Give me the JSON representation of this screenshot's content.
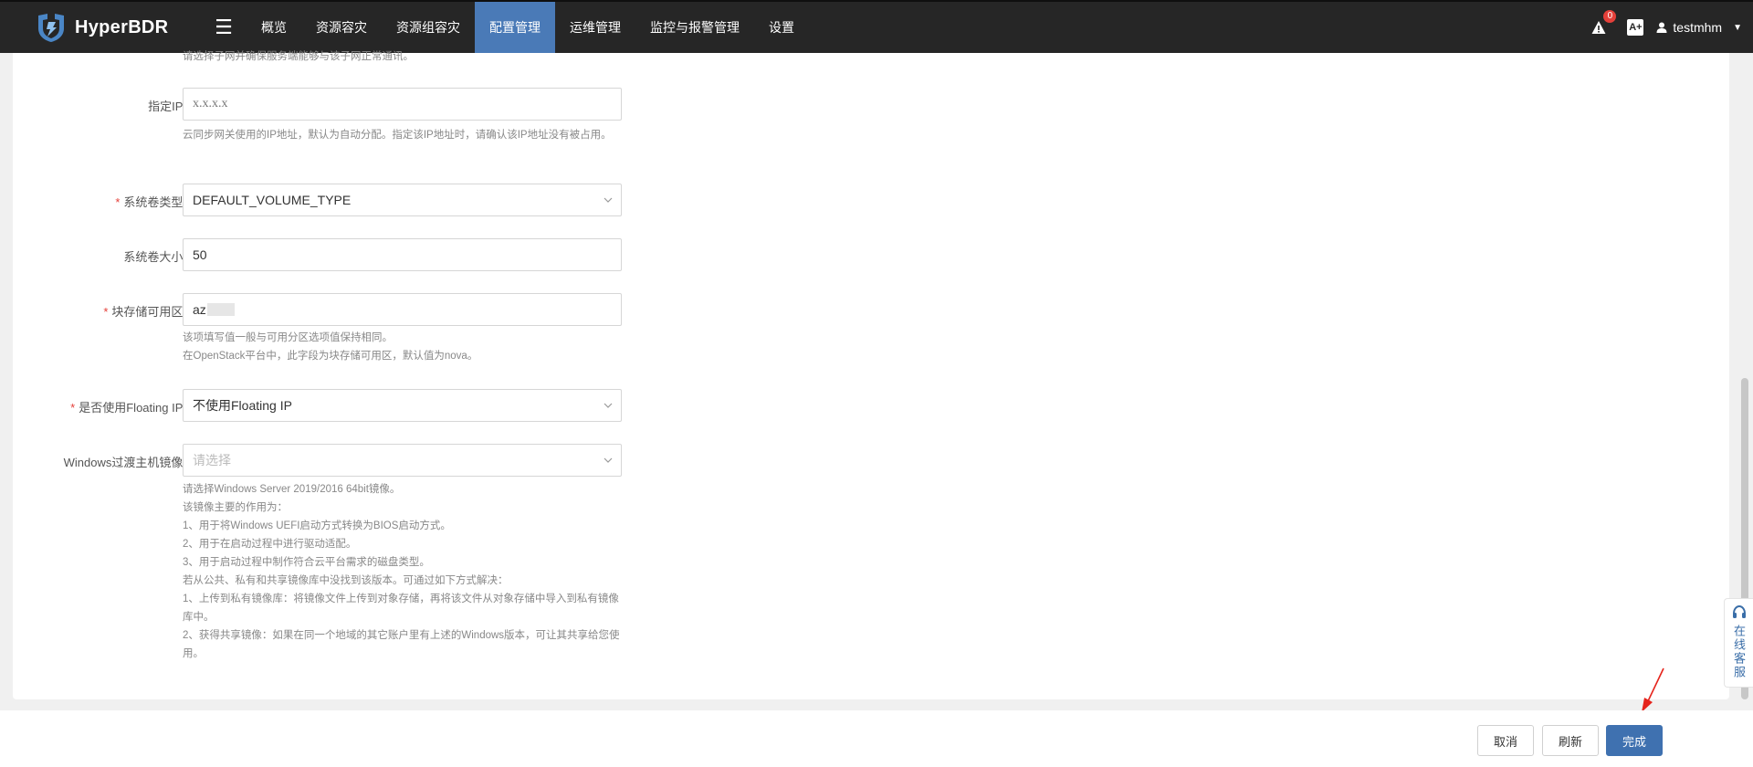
{
  "app": {
    "name": "HyperBDR"
  },
  "nav": {
    "items": [
      {
        "label": "概览",
        "active": false
      },
      {
        "label": "资源容灾",
        "active": false
      },
      {
        "label": "资源组容灾",
        "active": false
      },
      {
        "label": "配置管理",
        "active": true
      },
      {
        "label": "运维管理",
        "active": false
      },
      {
        "label": "监控与报警管理",
        "active": false
      },
      {
        "label": "设置",
        "active": false
      }
    ]
  },
  "header": {
    "notification_count": "0",
    "font_icon_text": "A+",
    "username": "testmhm"
  },
  "form": {
    "subnet_help_top": "请选择子网并确保服务端能够与该子网正常通讯。",
    "ip": {
      "label": "指定IP:",
      "value": "",
      "placeholder": "x.x.x.x",
      "help": "云同步网关使用的IP地址，默认为自动分配。指定该IP地址时，请确认该IP地址没有被占用。"
    },
    "volume_type": {
      "label": "系统卷类型:",
      "required": true,
      "value": "DEFAULT_VOLUME_TYPE"
    },
    "volume_size": {
      "label": "系统卷大小:",
      "value": "50"
    },
    "block_az": {
      "label": "块存储可用区:",
      "required": true,
      "value": "az",
      "help_lines": [
        "该项填写值一般与可用分区选项值保持相同。",
        "在OpenStack平台中，此字段为块存储可用区，默认值为nova。"
      ]
    },
    "floating_ip": {
      "label": "是否使用Floating IP:",
      "required": true,
      "value": "不使用Floating IP"
    },
    "windows_image": {
      "label": "Windows过渡主机镜像:",
      "placeholder": "请选择",
      "help_lines": [
        "请选择Windows Server 2019/2016 64bit镜像。",
        "该镜像主要的作用为：",
        "1、用于将Windows UEFI启动方式转换为BIOS启动方式。",
        "2、用于在启动过程中进行驱动适配。",
        "3、用于启动过程中制作符合云平台需求的磁盘类型。",
        "若从公共、私有和共享镜像库中没找到该版本。可通过如下方式解决：",
        "1、上传到私有镜像库：将镜像文件上传到对象存储，再将该文件从对象存储中导入到私有镜像库中。",
        "2、获得共享镜像：如果在同一个地域的其它账户里有上述的Windows版本，可让其共享给您使用。"
      ]
    }
  },
  "service_widget": {
    "label": "在线客服"
  },
  "footer": {
    "cancel": "取消",
    "refresh": "刷新",
    "finish": "完成"
  },
  "colors": {
    "nav_bg": "#262626",
    "nav_active": "#4a7ab7",
    "primary": "#3f71b0",
    "required": "#e5403a",
    "annotation_arrow": "#e5231b"
  }
}
